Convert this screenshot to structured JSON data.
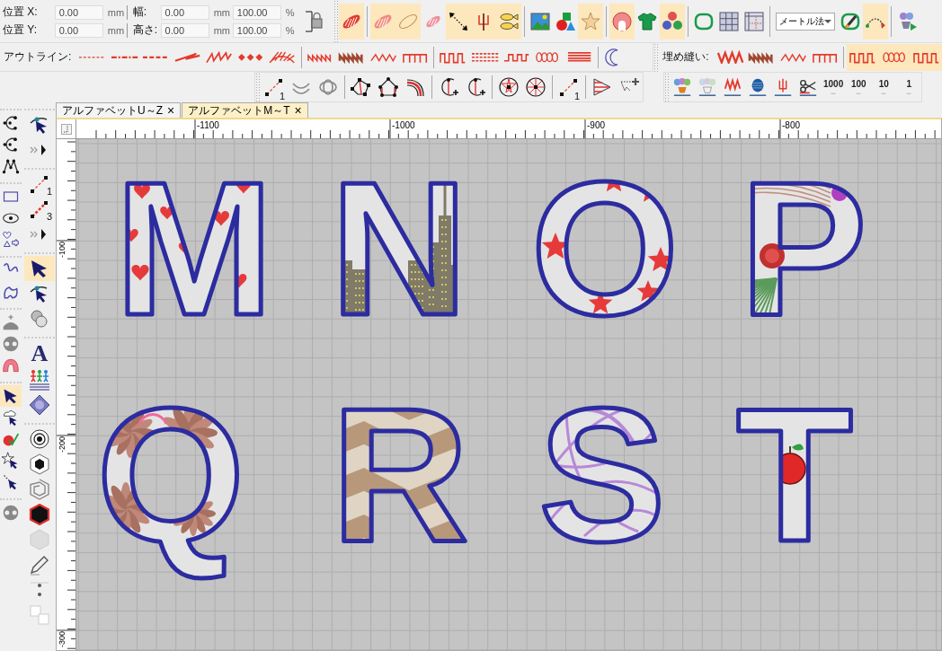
{
  "position_fields": [
    {
      "label": "位置 X:",
      "value": "0.00",
      "unit": "mm"
    },
    {
      "label": "位置 Y:",
      "value": "0.00",
      "unit": "mm"
    }
  ],
  "size_fields": [
    {
      "label": "幅:",
      "value": "0.00",
      "unit": "mm",
      "percent": "100.00",
      "percent_unit": "%"
    },
    {
      "label": "高さ:",
      "value": "0.00",
      "unit": "mm",
      "percent": "100.00",
      "percent_unit": "%"
    }
  ],
  "main_toolbar": {
    "groups": [
      [
        {
          "kind": "fill-leaf",
          "selected": true
        }
      ],
      [
        {
          "kind": "fill-leaf-light",
          "selected": true
        },
        {
          "kind": "leaf-outline",
          "selected": true
        },
        {
          "kind": "fill-leaf-small",
          "selected": false
        },
        {
          "kind": "dotted-line",
          "selected": true
        },
        {
          "kind": "fork",
          "selected": true
        },
        {
          "kind": "fish",
          "selected": true
        }
      ],
      [
        {
          "kind": "landscape",
          "selected": false
        },
        {
          "kind": "shapes",
          "selected": false
        },
        {
          "kind": "starfish",
          "selected": true
        }
      ],
      [
        {
          "kind": "blob-ring",
          "selected": true
        },
        {
          "kind": "shirt",
          "selected": false
        },
        {
          "kind": "balls",
          "selected": true
        }
      ],
      [
        {
          "kind": "hoop",
          "selected": false
        },
        {
          "kind": "grid",
          "selected": false
        },
        {
          "kind": "grid-ruler",
          "selected": false
        }
      ],
      [
        {
          "kind": "dropdown",
          "value": "メートル法"
        },
        {
          "kind": "hoop-pen",
          "selected": false
        },
        {
          "kind": "arc-arrow",
          "selected": true
        }
      ],
      [
        {
          "kind": "flowers-play",
          "selected": false
        }
      ]
    ]
  },
  "outline_toolbar": {
    "label": "アウトライン:",
    "groups": [
      [
        {
          "kind": "dash",
          "selected": false
        },
        {
          "kind": "dash-dot",
          "selected": false
        },
        {
          "kind": "dash-thick",
          "selected": false
        },
        {
          "kind": "zigzag-line",
          "selected": false
        },
        {
          "kind": "zigzag-dense",
          "selected": false
        },
        {
          "kind": "diamonds",
          "selected": false
        },
        {
          "kind": "fan",
          "selected": false
        }
      ],
      [
        {
          "kind": "zigzag-small",
          "selected": false
        },
        {
          "kind": "zigzag-dark",
          "selected": false
        },
        {
          "kind": "zigzag-thin",
          "selected": false
        },
        {
          "kind": "comb",
          "selected": false
        }
      ],
      [
        {
          "kind": "square-wave",
          "selected": false
        },
        {
          "kind": "bars",
          "selected": false
        },
        {
          "kind": "meander",
          "selected": false
        },
        {
          "kind": "coil",
          "selected": false
        },
        {
          "kind": "stripes",
          "selected": false
        }
      ],
      [
        {
          "kind": "crescent",
          "selected": false
        }
      ]
    ]
  },
  "fill_toolbar": {
    "label": "埋め縫い:",
    "groups": [
      [
        {
          "kind": "zigzag-big",
          "selected": false
        },
        {
          "kind": "zigzag-dark",
          "selected": false
        },
        {
          "kind": "zigzag-thin",
          "selected": false
        },
        {
          "kind": "comb",
          "selected": false
        }
      ],
      [
        {
          "kind": "square-wave",
          "selected": true
        },
        {
          "kind": "coil",
          "selected": true
        },
        {
          "kind": "square-wave",
          "selected": true
        }
      ]
    ]
  },
  "edit_toolbar": {
    "groups": [
      [
        {
          "kind": "node-line",
          "label": "1",
          "selected": false
        },
        {
          "kind": "arcs",
          "selected": false
        },
        {
          "kind": "rotate-circles",
          "selected": false
        }
      ],
      [
        {
          "kind": "polygon-nodes",
          "selected": false
        },
        {
          "kind": "pentagon-nodes",
          "selected": false
        },
        {
          "kind": "curve-nodes",
          "selected": false
        }
      ],
      [
        {
          "kind": "c-split",
          "selected": false
        },
        {
          "kind": "c-join",
          "selected": false
        }
      ],
      [
        {
          "kind": "circle-star",
          "selected": false
        },
        {
          "kind": "circle-spokes",
          "selected": false
        }
      ],
      [
        {
          "kind": "node-line",
          "label": "1",
          "selected": false
        }
      ],
      [
        {
          "kind": "triangle-stripes",
          "selected": false
        },
        {
          "kind": "select-plus",
          "selected": false
        }
      ]
    ]
  },
  "step_toolbar": {
    "groups": [
      [
        {
          "kind": "flowers",
          "selected": false
        },
        {
          "kind": "flowers-dim",
          "selected": false
        },
        {
          "kind": "zigzag-arrows",
          "selected": false
        },
        {
          "kind": "spool",
          "selected": false
        },
        {
          "kind": "fork-arrows",
          "selected": false
        },
        {
          "kind": "scissors",
          "selected": false
        },
        {
          "kind": "step",
          "label": "1000",
          "selected": false
        },
        {
          "kind": "step",
          "label": "100",
          "selected": false
        },
        {
          "kind": "step",
          "label": "10",
          "selected": false
        },
        {
          "kind": "step",
          "label": "1",
          "selected": false
        }
      ]
    ]
  },
  "tabs": [
    {
      "label": "アルファベットU～Z",
      "close": "×",
      "selected": false
    },
    {
      "label": "アルファベットM～T",
      "close": "×",
      "selected": true
    }
  ],
  "left_toolbars": [
    {
      "groups": [
        [
          {
            "kind": "c-nodes",
            "selected": false
          },
          {
            "kind": "c-nodes",
            "selected": false
          },
          {
            "kind": "w-nodes",
            "selected": false
          }
        ],
        [
          {
            "kind": "rect",
            "selected": false
          },
          {
            "kind": "eye",
            "selected": false
          },
          {
            "kind": "heart-shapes",
            "selected": false
          }
        ],
        [
          {
            "kind": "squiggle",
            "selected": false
          },
          {
            "kind": "blob-outline",
            "selected": false
          }
        ],
        [
          {
            "kind": "crown",
            "selected": false
          },
          {
            "kind": "split-circle",
            "selected": false
          },
          {
            "kind": "fan-arch",
            "selected": false
          }
        ],
        [
          {
            "kind": "select-arrow",
            "selected": true
          },
          {
            "kind": "cloud-arrow",
            "selected": false
          },
          {
            "kind": "apple-select",
            "selected": false
          },
          {
            "kind": "star-arrow",
            "selected": false
          },
          {
            "kind": "cut-arrow",
            "selected": false
          }
        ],
        [
          {
            "kind": "split-circle",
            "selected": false
          }
        ]
      ]
    },
    {
      "groups": [
        [
          {
            "kind": "node-arrow",
            "selected": false
          },
          {
            "kind": "more",
            "selected": false
          }
        ],
        [
          {
            "kind": "node-line",
            "label": "1",
            "selected": false
          },
          {
            "kind": "node-line-thick",
            "label": "3",
            "selected": false
          },
          {
            "kind": "more",
            "selected": false
          }
        ],
        [
          {
            "kind": "select-arrow",
            "selected": true
          },
          {
            "kind": "node-arrow",
            "selected": false
          },
          {
            "kind": "balls-pair",
            "selected": false
          }
        ],
        [
          {
            "kind": "letter",
            "label": "A",
            "selected": false
          },
          {
            "kind": "people",
            "selected": false
          },
          {
            "kind": "diamond",
            "selected": false
          }
        ],
        [
          {
            "kind": "target",
            "selected": false
          },
          {
            "kind": "hexagon-rings",
            "selected": false
          },
          {
            "kind": "hex-spiral",
            "selected": false
          },
          {
            "kind": "hexagon-outlined",
            "selected": false
          },
          {
            "kind": "hexagon-faint",
            "selected": false
          },
          {
            "kind": "pencil",
            "selected": false
          },
          {
            "kind": "dots",
            "selected": false
          },
          {
            "kind": "squares",
            "selected": false
          }
        ]
      ]
    }
  ],
  "rulers": {
    "x_labels": [
      "-1100",
      "-1000",
      "-900",
      "-800"
    ],
    "y_labels": [
      "-100",
      "-200",
      "-300"
    ]
  },
  "designs": [
    {
      "letter": "M",
      "kind": "hearts"
    },
    {
      "letter": "N",
      "kind": "city"
    },
    {
      "letter": "O",
      "kind": "stars"
    },
    {
      "letter": "P",
      "kind": "floral"
    },
    {
      "letter": "Q",
      "kind": "flowers"
    },
    {
      "letter": "R",
      "kind": "zigzag"
    },
    {
      "letter": "S",
      "kind": "swirls"
    },
    {
      "letter": "T",
      "kind": "apple"
    }
  ]
}
